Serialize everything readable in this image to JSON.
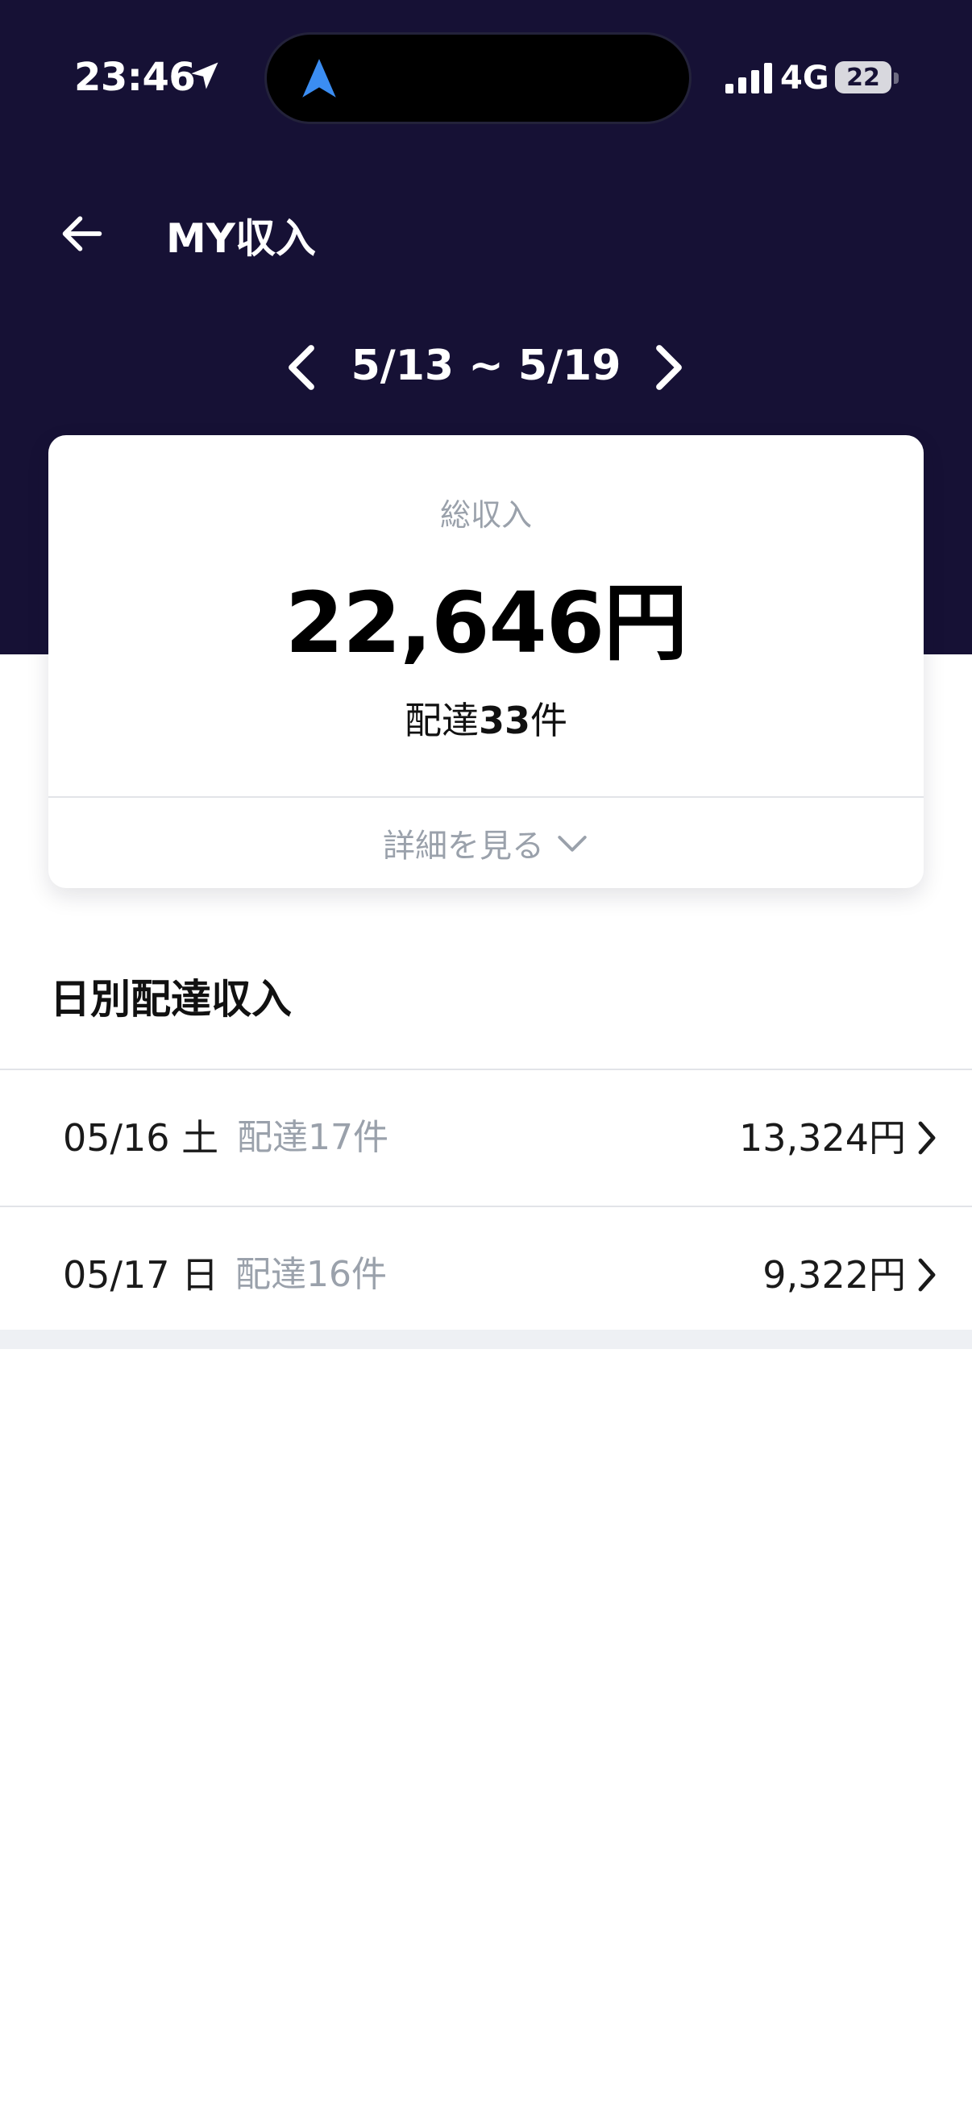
{
  "status_bar": {
    "time": "23:46",
    "network": "4G",
    "battery": "22"
  },
  "header": {
    "title": "MY収入",
    "back_icon": "arrow-left-icon",
    "background": "#161135"
  },
  "week": {
    "range": "5/13 ~ 5/19"
  },
  "summary": {
    "label": "総収入",
    "total": "22,646円",
    "count_prefix": "配達",
    "count_value": "33",
    "count_suffix": "件",
    "detail_label": "詳細を見る"
  },
  "daily": {
    "title": "日別配達収入",
    "rows": [
      {
        "date": "05/16 土",
        "count": "配達17件",
        "amount": "13,324円"
      },
      {
        "date": "05/17 日",
        "count": "配達16件",
        "amount": "9,322円"
      }
    ]
  },
  "colors": {
    "header_bg": "#161135",
    "muted_text": "#9aa1ab",
    "accent_nav": "#3b8df2"
  }
}
